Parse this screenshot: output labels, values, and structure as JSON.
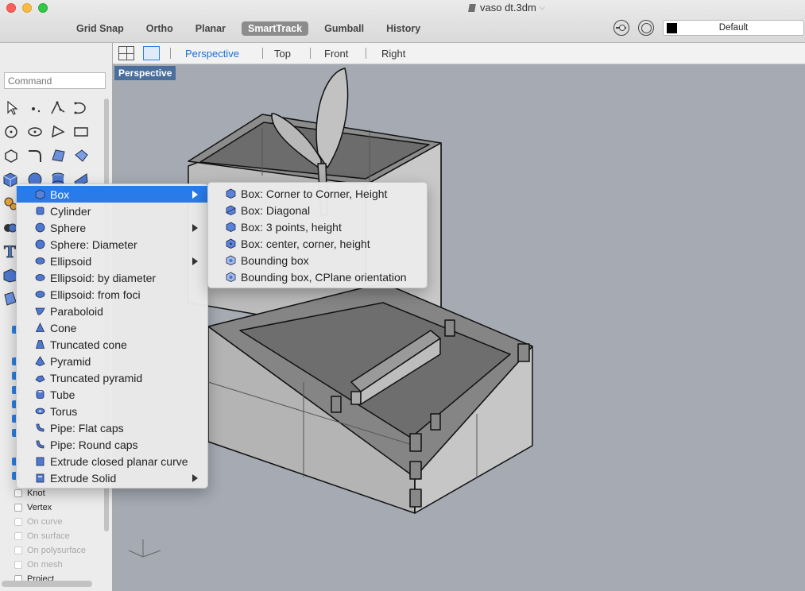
{
  "window": {
    "title": "vaso dt.3dm"
  },
  "modes": [
    {
      "label": "Grid Snap",
      "active": false
    },
    {
      "label": "Ortho",
      "active": false
    },
    {
      "label": "Planar",
      "active": false
    },
    {
      "label": "SmartTrack",
      "active": true
    },
    {
      "label": "Gumball",
      "active": false
    },
    {
      "label": "History",
      "active": false
    }
  ],
  "layer": {
    "name": "Default",
    "color": "#000000"
  },
  "viewport_tabs": [
    {
      "label": "Perspective",
      "active": true
    },
    {
      "label": "Top",
      "active": false
    },
    {
      "label": "Front",
      "active": false
    },
    {
      "label": "Right",
      "active": false
    }
  ],
  "viewport": {
    "label": "Perspective"
  },
  "command": {
    "placeholder": "Command"
  },
  "osnaps": [
    {
      "label": "Knot",
      "enabled": true
    },
    {
      "label": "Vertex",
      "enabled": true
    },
    {
      "label": "On curve",
      "enabled": false
    },
    {
      "label": "On surface",
      "enabled": false
    },
    {
      "label": "On polysurface",
      "enabled": false
    },
    {
      "label": "On mesh",
      "enabled": false
    },
    {
      "label": "Project",
      "enabled": true
    }
  ],
  "solid_menu": {
    "items": [
      {
        "label": "Box",
        "submenu": true,
        "highlighted": true,
        "icon": "box-icon"
      },
      {
        "label": "Cylinder",
        "submenu": false,
        "icon": "cylinder-icon"
      },
      {
        "label": "Sphere",
        "submenu": true,
        "icon": "sphere-icon"
      },
      {
        "label": "Sphere: Diameter",
        "submenu": false,
        "icon": "sphere-icon"
      },
      {
        "label": "Ellipsoid",
        "submenu": true,
        "icon": "ellipsoid-icon"
      },
      {
        "label": "Ellipsoid: by diameter",
        "submenu": false,
        "icon": "ellipsoid-icon"
      },
      {
        "label": "Ellipsoid: from foci",
        "submenu": false,
        "icon": "ellipsoid-icon"
      },
      {
        "label": "Paraboloid",
        "submenu": false,
        "icon": "paraboloid-icon"
      },
      {
        "label": "Cone",
        "submenu": false,
        "icon": "cone-icon"
      },
      {
        "label": "Truncated cone",
        "submenu": false,
        "icon": "cone-icon"
      },
      {
        "label": "Pyramid",
        "submenu": false,
        "icon": "pyramid-icon"
      },
      {
        "label": "Truncated pyramid",
        "submenu": false,
        "icon": "pyramid-icon"
      },
      {
        "label": "Tube",
        "submenu": false,
        "icon": "tube-icon"
      },
      {
        "label": "Torus",
        "submenu": false,
        "icon": "torus-icon"
      },
      {
        "label": "Pipe: Flat caps",
        "submenu": false,
        "icon": "pipe-icon"
      },
      {
        "label": "Pipe: Round caps",
        "submenu": false,
        "icon": "pipe-icon"
      },
      {
        "label": "Extrude closed planar curve",
        "submenu": false,
        "icon": "extrude-icon"
      },
      {
        "label": "Extrude Solid",
        "submenu": true,
        "icon": "extrude-icon"
      }
    ]
  },
  "box_submenu": {
    "items": [
      {
        "label": "Box: Corner to Corner, Height",
        "icon": "box-icon"
      },
      {
        "label": "Box: Diagonal",
        "icon": "box-icon"
      },
      {
        "label": "Box: 3 points, height",
        "icon": "box-icon"
      },
      {
        "label": "Box: center, corner, height",
        "icon": "box-icon"
      },
      {
        "label": "Bounding box",
        "icon": "bounding-box-icon"
      },
      {
        "label": "Bounding box, CPlane orientation",
        "icon": "bounding-box-icon"
      }
    ]
  },
  "colors": {
    "highlight": "#2a7bea",
    "viewport_bg": "#a5aab3",
    "viewport_label_bg": "#4a6f9c"
  }
}
